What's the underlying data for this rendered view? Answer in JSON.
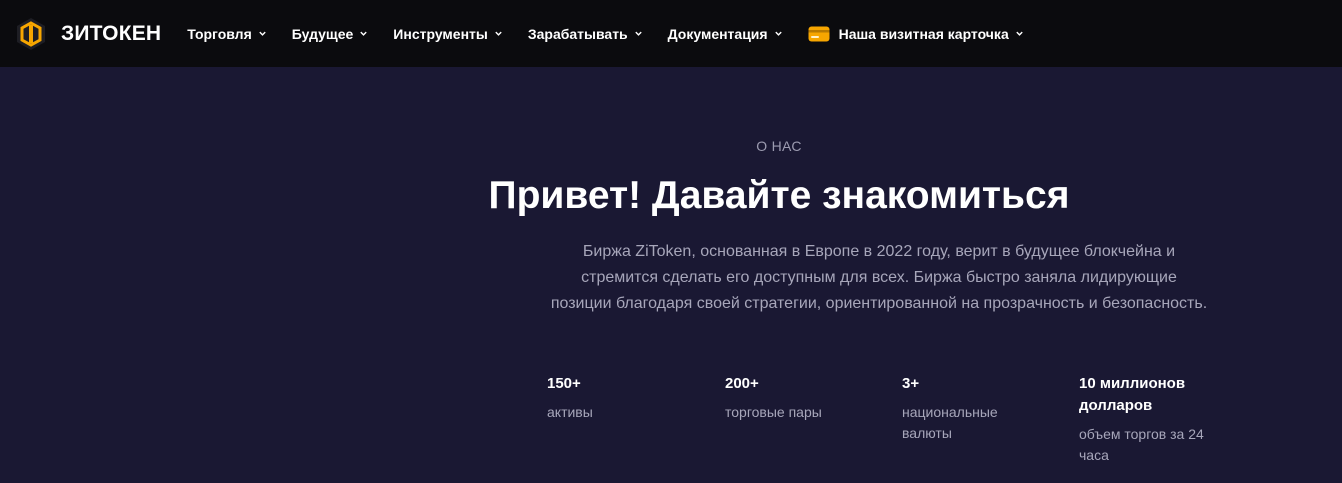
{
  "brand": {
    "name": "ЗИТОКЕН",
    "logo_icon": "hexagon-coin-logo-icon",
    "accent_color": "#f7a600"
  },
  "nav": {
    "items": [
      {
        "label": "Торговля",
        "icon": "chevron-down-icon"
      },
      {
        "label": "Будущее",
        "icon": "chevron-down-icon"
      },
      {
        "label": "Инструменты",
        "icon": "chevron-down-icon"
      },
      {
        "label": "Зарабатывать",
        "icon": "chevron-down-icon"
      },
      {
        "label": "Документация",
        "icon": "chevron-down-icon"
      },
      {
        "label": "Наша визитная карточка",
        "icon": "chevron-down-icon",
        "leading_icon": "business-card-icon"
      }
    ]
  },
  "about": {
    "eyebrow": "О НАС",
    "headline": "Привет! Давайте знакомиться",
    "description": "Биржа ZiToken, основанная в Европе в 2022 году, верит в будущее блокчейна и стремится сделать его доступным для всех. Биржа быстро заняла лидирующие позиции благодаря своей стратегии, ориентированной на прозрачность и безопасность."
  },
  "stats": [
    {
      "value": "150+",
      "label": "активы"
    },
    {
      "value": "200+",
      "label": "торговые пары"
    },
    {
      "value": "3+",
      "label": "национальные валюты"
    },
    {
      "value": "10 миллионов долларов",
      "label": "объем торгов за 24 часа"
    }
  ],
  "colors": {
    "nav_background": "#0b0b0e",
    "page_background": "#1a1833",
    "text_primary": "#ffffff",
    "text_secondary": "#a7a6ba"
  }
}
